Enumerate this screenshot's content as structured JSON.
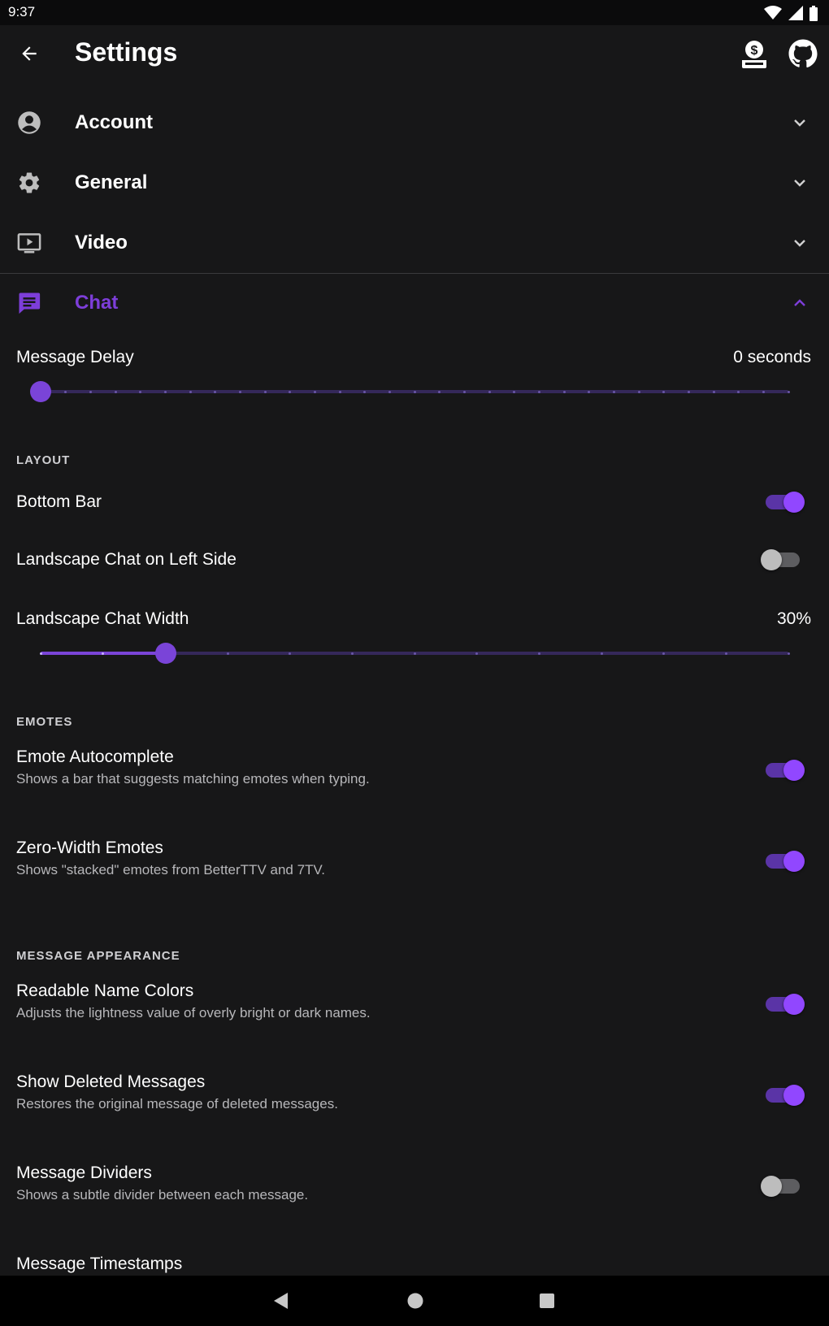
{
  "status_bar": {
    "time": "9:37"
  },
  "app_bar": {
    "title": "Settings"
  },
  "colors": {
    "accent": "#9147ff",
    "accent_text": "#7d3ed9",
    "background": "#171718"
  },
  "categories": [
    {
      "label": "Account",
      "icon": "account-circle-icon",
      "expanded": false
    },
    {
      "label": "General",
      "icon": "gear-icon",
      "expanded": false
    },
    {
      "label": "Video",
      "icon": "video-player-icon",
      "expanded": false
    },
    {
      "label": "Chat",
      "icon": "chat-message-icon",
      "expanded": true
    }
  ],
  "chat": {
    "message_delay": {
      "label": "Message Delay",
      "value": "0 seconds",
      "fraction": 0.0,
      "ticks": 31
    },
    "layout": {
      "header": "LAYOUT",
      "bottom_bar": {
        "label": "Bottom Bar",
        "on": true
      },
      "landscape_left": {
        "label": "Landscape Chat on Left Side",
        "on": false
      },
      "landscape_width": {
        "label": "Landscape Chat Width",
        "value": "30%",
        "fraction": 0.167,
        "ticks": 13
      }
    },
    "emotes": {
      "header": "EMOTES",
      "autocomplete": {
        "label": "Emote Autocomplete",
        "desc": "Shows a bar that suggests matching emotes when typing.",
        "on": true
      },
      "zero_width": {
        "label": "Zero-Width Emotes",
        "desc": "Shows \"stacked\" emotes from BetterTTV and 7TV.",
        "on": true
      }
    },
    "appearance": {
      "header": "MESSAGE APPEARANCE",
      "readable_colors": {
        "label": "Readable Name Colors",
        "desc": "Adjusts the lightness value of overly bright or dark names.",
        "on": true
      },
      "show_deleted": {
        "label": "Show Deleted Messages",
        "desc": "Restores the original message of deleted messages.",
        "on": true
      },
      "dividers": {
        "label": "Message Dividers",
        "desc": "Shows a subtle divider between each message.",
        "on": false
      },
      "timestamps": {
        "label": "Message Timestamps"
      }
    }
  }
}
